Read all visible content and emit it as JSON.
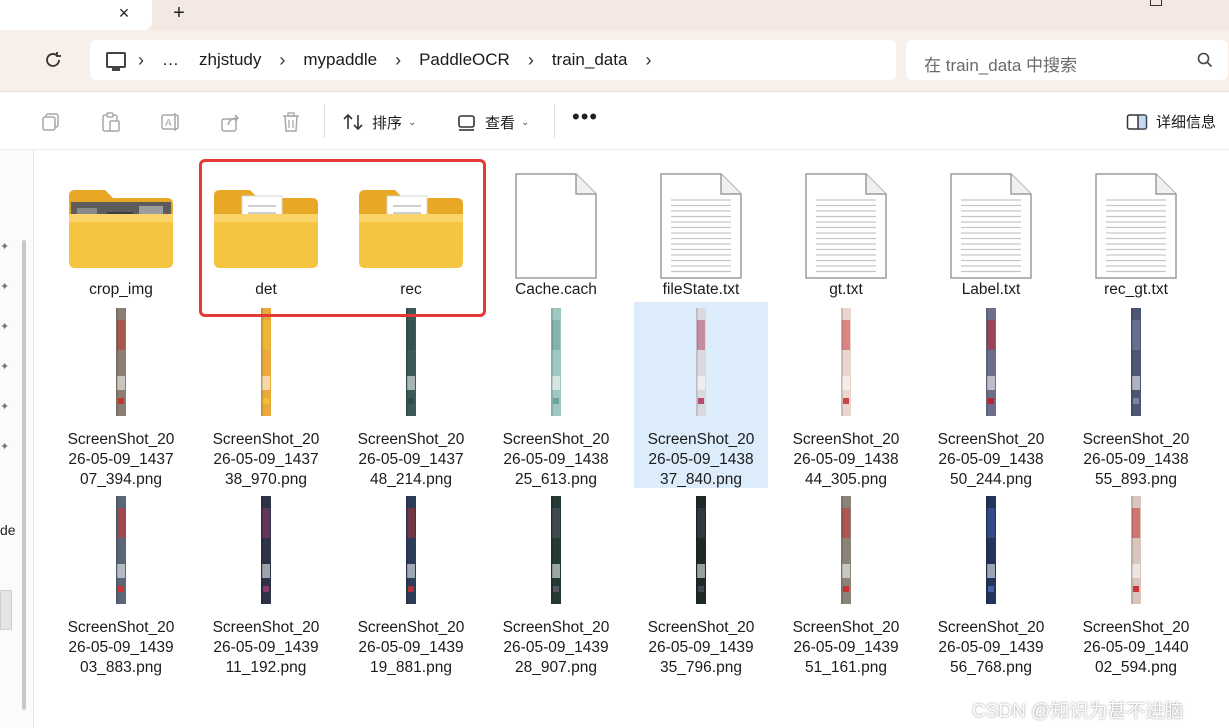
{
  "tab": {
    "close": "×",
    "add": "+"
  },
  "address": {
    "crumbs": [
      "…",
      "zhjstudy",
      "mypaddle",
      "PaddleOCR",
      "train_data"
    ],
    "sep": "›"
  },
  "search": {
    "placeholder": "在 train_data 中搜索"
  },
  "toolbar": {
    "sort_label": "排序",
    "view_label": "查看",
    "more_label": "•••",
    "details_label": "详细信息"
  },
  "nav": {
    "partial_text": "de"
  },
  "items": [
    {
      "name": "crop_img",
      "type": "folder-thumb"
    },
    {
      "name": "det",
      "type": "folder-doc"
    },
    {
      "name": "rec",
      "type": "folder-doc"
    },
    {
      "name": "Cache.cach",
      "type": "file-blank"
    },
    {
      "name": "fileState.txt",
      "type": "file-text"
    },
    {
      "name": "gt.txt",
      "type": "file-text"
    },
    {
      "name": "Label.txt",
      "type": "file-text"
    },
    {
      "name": "rec_gt.txt",
      "type": "file-text"
    },
    {
      "name": [
        "ScreenShot_20",
        "26-05-09_1437",
        "07_394.png"
      ],
      "type": "image",
      "color": "#8a7f72",
      "accent": "#c0392b"
    },
    {
      "name": [
        "ScreenShot_20",
        "26-05-09_1437",
        "38_970.png"
      ],
      "type": "image",
      "color": "#e8a93a",
      "accent": "#f0c030"
    },
    {
      "name": [
        "ScreenShot_20",
        "26-05-09_1437",
        "48_214.png"
      ],
      "type": "image",
      "color": "#3c5a5a",
      "accent": "#2e4a4a"
    },
    {
      "name": [
        "ScreenShot_20",
        "26-05-09_1438",
        "25_613.png"
      ],
      "type": "image",
      "color": "#9fc7c2",
      "accent": "#6aa39b"
    },
    {
      "name": [
        "ScreenShot_20",
        "26-05-09_1438",
        "37_840.png"
      ],
      "type": "image",
      "color": "#d9d9e0",
      "accent": "#b54a6a",
      "selected": true
    },
    {
      "name": [
        "ScreenShot_20",
        "26-05-09_1438",
        "44_305.png"
      ],
      "type": "image",
      "color": "#e8d6cf",
      "accent": "#c44"
    },
    {
      "name": [
        "ScreenShot_20",
        "26-05-09_1438",
        "50_244.png"
      ],
      "type": "image",
      "color": "#6d6f8a",
      "accent": "#b23"
    },
    {
      "name": [
        "ScreenShot_20",
        "26-05-09_1438",
        "55_893.png"
      ],
      "type": "image",
      "color": "#4e5676",
      "accent": "#7a84a8"
    },
    {
      "name": [
        "ScreenShot_20",
        "26-05-09_1439",
        "03_883.png"
      ],
      "type": "image",
      "color": "#5b6678",
      "accent": "#c33"
    },
    {
      "name": [
        "ScreenShot_20",
        "26-05-09_1439",
        "11_192.png"
      ],
      "type": "image",
      "color": "#2f3348",
      "accent": "#8b3a6a"
    },
    {
      "name": [
        "ScreenShot_20",
        "26-05-09_1439",
        "19_881.png"
      ],
      "type": "image",
      "color": "#2c3c58",
      "accent": "#a33"
    },
    {
      "name": [
        "ScreenShot_20",
        "26-05-09_1439",
        "28_907.png"
      ],
      "type": "image",
      "color": "#243a34",
      "accent": "#556"
    },
    {
      "name": [
        "ScreenShot_20",
        "26-05-09_1439",
        "35_796.png"
      ],
      "type": "image",
      "color": "#1e2a28",
      "accent": "#445"
    },
    {
      "name": [
        "ScreenShot_20",
        "26-05-09_1439",
        "51_161.png"
      ],
      "type": "image",
      "color": "#8a8478",
      "accent": "#c33"
    },
    {
      "name": [
        "ScreenShot_20",
        "26-05-09_1439",
        "56_768.png"
      ],
      "type": "image",
      "color": "#24335a",
      "accent": "#3f5fa8"
    },
    {
      "name": [
        "ScreenShot_20",
        "26-05-09_1440",
        "02_594.png"
      ],
      "type": "image",
      "color": "#d8c6bc",
      "accent": "#c33"
    }
  ],
  "watermark": "CSDN @知识为甚不进脑"
}
